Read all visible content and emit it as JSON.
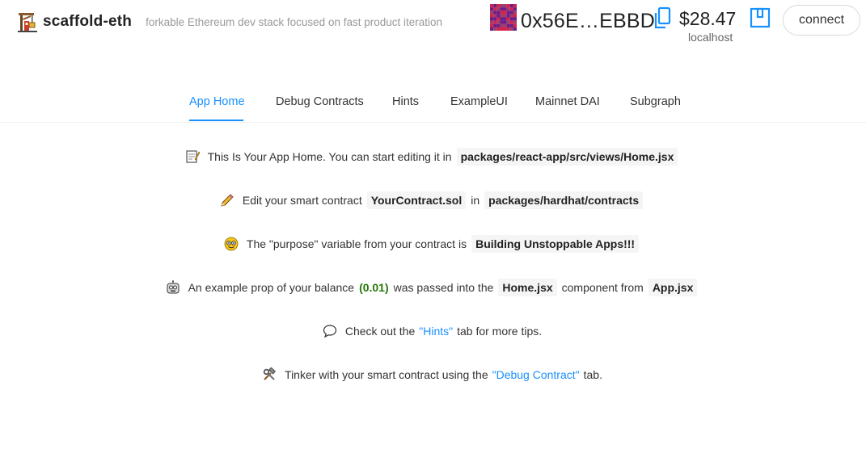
{
  "header": {
    "title": "scaffold-eth",
    "subtitle": "forkable Ethereum dev stack focused on fast product iteration",
    "logo_icon": "crane-emoji-icon",
    "account": {
      "address": "0x56E…EBBD",
      "balance": "$28.47",
      "network": "localhost",
      "blockie_colors": [
        "#d1234b",
        "#6b1f8a",
        "#a03d6a"
      ]
    },
    "connect_label": "connect"
  },
  "nav": {
    "tabs": [
      {
        "label": "App Home",
        "active": true
      },
      {
        "label": "Debug Contracts",
        "active": false
      },
      {
        "label": "Hints",
        "active": false
      },
      {
        "label": "ExampleUI",
        "active": false
      },
      {
        "label": "Mainnet DAI",
        "active": false
      },
      {
        "label": "Subgraph",
        "active": false
      }
    ]
  },
  "home": {
    "row1": {
      "icon": "memo-icon",
      "text": "This Is Your App Home. You can start editing it in",
      "code": "packages/react-app/src/views/Home.jsx"
    },
    "row2": {
      "icon": "pencil-icon",
      "text1": "Edit your smart contract",
      "code1": "YourContract.sol",
      "text2": "in",
      "code2": "packages/hardhat/contracts"
    },
    "row3": {
      "icon": "nerd-face-icon",
      "text": "The \"purpose\" variable from your contract is",
      "code": "Building Unstoppable Apps!!!"
    },
    "row4": {
      "icon": "robot-icon",
      "text1": "An example prop of your balance",
      "value": "(0.01)",
      "text2": "was passed into the",
      "code1": "Home.jsx",
      "text3": "component from",
      "code2": "App.jsx"
    },
    "row5": {
      "icon": "speech-bubble-icon",
      "text1": "Check out the",
      "link": "\"Hints\"",
      "text2": "tab for more tips."
    },
    "row6": {
      "icon": "hammer-wrench-icon",
      "text1": "Tinker with your smart contract using the",
      "link": "\"Debug Contract\"",
      "text2": "tab."
    }
  },
  "colors": {
    "accent": "#1890ff",
    "balance_green": "#237804",
    "code_bg": "#f5f5f5"
  }
}
